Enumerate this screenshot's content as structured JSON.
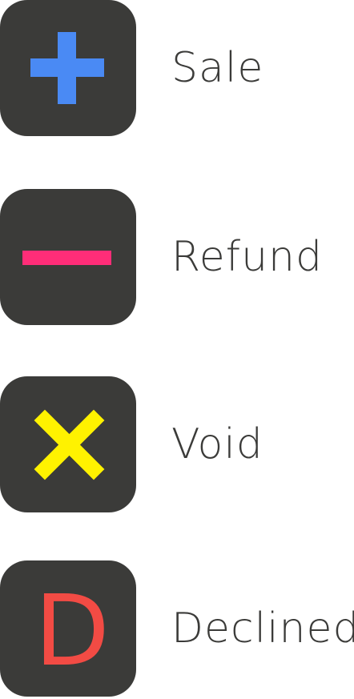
{
  "legend": {
    "items": [
      {
        "label": "Sale",
        "icon": "plus-icon",
        "color": "#4a8af4"
      },
      {
        "label": "Refund",
        "icon": "minus-icon",
        "color": "#ff2d78"
      },
      {
        "label": "Void",
        "icon": "x-icon",
        "color": "#fff200"
      },
      {
        "label": "Declined",
        "icon": "letter-d-icon",
        "glyph": "D",
        "color": "#f24b44"
      }
    ],
    "tile_color": "#3b3b39",
    "text_color": "#3b3b39"
  }
}
